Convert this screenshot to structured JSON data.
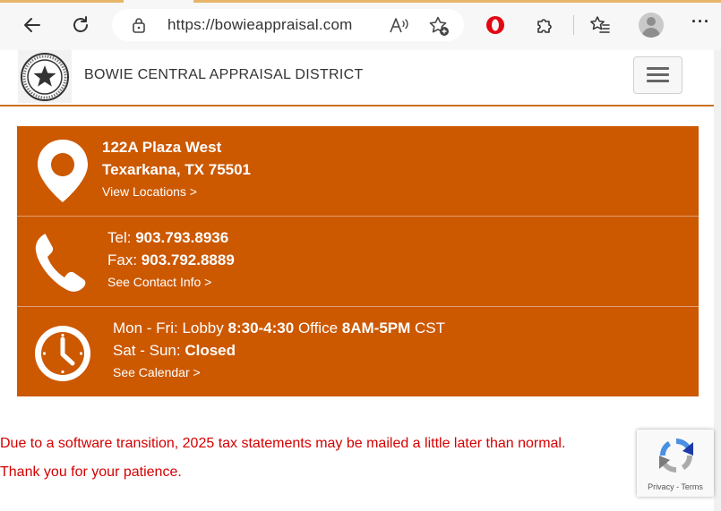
{
  "browser": {
    "url": "https://bowieappraisal.com",
    "icons": [
      "back-icon",
      "refresh-icon",
      "lock-icon",
      "read-aloud-icon",
      "add-favorite-icon",
      "opera-icon",
      "extensions-icon",
      "favorites-icon",
      "profile-avatar",
      "more-icon"
    ],
    "more_label": "···"
  },
  "header": {
    "title": "BOWIE CENTRAL APPRAISAL DISTRICT",
    "menu_icon": "hamburger-menu-icon"
  },
  "location": {
    "line1": "122A Plaza West",
    "line2": "Texarkana, TX 75501",
    "link": "View Locations >"
  },
  "contact": {
    "tel_label": "Tel: ",
    "tel_value": "903.793.8936",
    "fax_label": "Fax: ",
    "fax_value": "903.792.8889",
    "link": "See Contact Info >"
  },
  "hours": {
    "weekday_label": "Mon - Fri: Lobby ",
    "lobby_hours": "8:30-4:30",
    "office_label": " Office ",
    "office_hours": "8AM-5PM",
    "tz": " CST",
    "weekend_label": "Sat - Sun: ",
    "weekend_value": "Closed",
    "link": "See Calendar >"
  },
  "notice": {
    "line1": "Due to a software transition, 2025 tax statements may be mailed a little later than normal.",
    "line2": "Thank you for your patience."
  },
  "recaptcha": {
    "privacy": "Privacy",
    "sep": " - ",
    "terms": "Terms"
  },
  "colors": {
    "accent": "#cc5800",
    "notice": "#d40000",
    "header_rule": "#c8701f"
  }
}
